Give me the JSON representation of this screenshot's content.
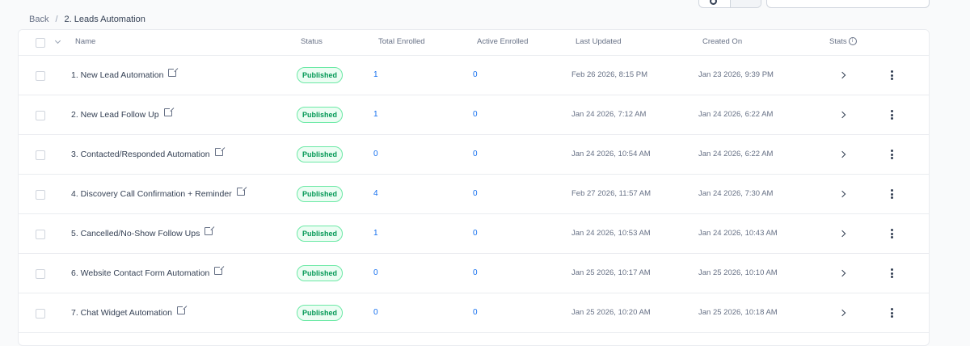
{
  "breadcrumb": {
    "back": "Back",
    "separator": "/",
    "current": "2. Leads Automation"
  },
  "columns": {
    "name": "Name",
    "status": "Status",
    "total_enrolled": "Total Enrolled",
    "active_enrolled": "Active Enrolled",
    "last_updated": "Last Updated",
    "created_on": "Created On",
    "stats": "Stats"
  },
  "colors": {
    "accent": "#1570ef",
    "published_text": "#039855",
    "published_bg": "#ecfdf3",
    "published_border": "#6ce9a6"
  },
  "icons": {
    "external_link": "external-link-icon",
    "stats_info": "info-icon",
    "row_open": "chevron-right-icon",
    "row_menu": "more-vertical-icon",
    "select_all_menu": "chevron-down-icon"
  },
  "rows": [
    {
      "name": "1. New Lead Automation",
      "status": "Published",
      "total_enrolled": "1",
      "active_enrolled": "0",
      "last_updated": "Feb 26 2026, 8:15 PM",
      "created_on": "Jan 23 2026, 9:39 PM"
    },
    {
      "name": "2. New Lead Follow Up",
      "status": "Published",
      "total_enrolled": "1",
      "active_enrolled": "0",
      "last_updated": "Jan 24 2026, 7:12 AM",
      "created_on": "Jan 24 2026, 6:22 AM"
    },
    {
      "name": "3. Contacted/Responded Automation",
      "status": "Published",
      "total_enrolled": "0",
      "active_enrolled": "0",
      "last_updated": "Jan 24 2026, 10:54 AM",
      "created_on": "Jan 24 2026, 6:22 AM"
    },
    {
      "name": "4. Discovery Call Confirmation + Reminder",
      "status": "Published",
      "total_enrolled": "4",
      "active_enrolled": "0",
      "last_updated": "Feb 27 2026, 11:57 AM",
      "created_on": "Jan 24 2026, 7:30 AM"
    },
    {
      "name": "5. Cancelled/No-Show Follow Ups",
      "status": "Published",
      "total_enrolled": "1",
      "active_enrolled": "0",
      "last_updated": "Jan 24 2026, 10:53 AM",
      "created_on": "Jan 24 2026, 10:43 AM"
    },
    {
      "name": "6. Website Contact Form Automation",
      "status": "Published",
      "total_enrolled": "0",
      "active_enrolled": "0",
      "last_updated": "Jan 25 2026, 10:17 AM",
      "created_on": "Jan 25 2026, 10:10 AM"
    },
    {
      "name": "7. Chat Widget Automation",
      "status": "Published",
      "total_enrolled": "0",
      "active_enrolled": "0",
      "last_updated": "Jan 25 2026, 10:20 AM",
      "created_on": "Jan 25 2026, 10:18 AM"
    }
  ]
}
